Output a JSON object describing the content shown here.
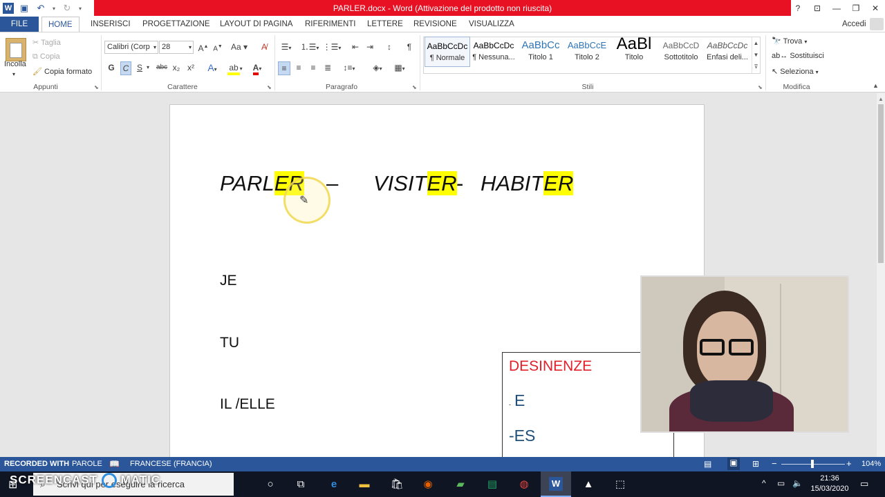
{
  "titlebar": {
    "title": "PARLER.docx  -  Word (Attivazione del prodotto non riuscita)",
    "help": "?",
    "ribbon_display": "⊡",
    "minimize": "—",
    "restore": "❐",
    "close": "✕"
  },
  "tabs": {
    "file": "FILE",
    "home": "HOME",
    "insert": "INSERISCI",
    "design": "PROGETTAZIONE",
    "layout": "LAYOUT DI PAGINA",
    "references": "RIFERIMENTI",
    "mailings": "LETTERE",
    "review": "REVISIONE",
    "view": "VISUALIZZA",
    "signin": "Accedi"
  },
  "clipboard": {
    "paste": "Incolla",
    "cut": "Taglia",
    "copy": "Copia",
    "format_painter": "Copia formato",
    "group": "Appunti"
  },
  "font": {
    "name": "Calibri (Corp",
    "size": "28",
    "bold": "G",
    "italic": "C",
    "underline": "S",
    "strike": "abc",
    "subscript": "x₂",
    "superscript": "x²",
    "group": "Carattere"
  },
  "paragraph": {
    "group": "Paragrafo"
  },
  "styles": {
    "group": "Stili",
    "items": [
      {
        "preview": "AaBbCcDc",
        "name": "¶ Normale"
      },
      {
        "preview": "AaBbCcDc",
        "name": "¶ Nessuna..."
      },
      {
        "preview": "AaBbCc",
        "name": "Titolo 1"
      },
      {
        "preview": "AaBbCcE",
        "name": "Titolo 2"
      },
      {
        "preview": "AaBl",
        "name": "Titolo"
      },
      {
        "preview": "AaBbCcD",
        "name": "Sottotitolo"
      },
      {
        "preview": "AaBbCcDc",
        "name": "Enfasi deli..."
      }
    ]
  },
  "editing": {
    "find": "Trova",
    "replace": "Sostituisci",
    "select": "Seleziona",
    "group": "Modifica"
  },
  "document": {
    "w1a": "PARL",
    "w1b": "ER",
    "dash1": "–",
    "w2a": "VISIT",
    "w2b": "ER",
    "dash2": "-",
    "w3a": "HABIT",
    "w3b": "ER",
    "p1": "JE",
    "p2": "TU",
    "p3": "IL /ELLE",
    "desinenze_title": "DESINENZE",
    "d1_dash": "-",
    "d1": "E",
    "d2": "-ES"
  },
  "colors": {
    "word_blue": "#2b579a",
    "title_red": "#e81123",
    "highlight": "#ffff00",
    "desinenze_red": "#e0202a",
    "desinenze_blue": "#1f4e79"
  },
  "statusbar": {
    "words": "PAROLE",
    "recorded": "RECORDED WITH",
    "language": "FRANCESE (FRANCIA)",
    "zoom": "104%"
  },
  "taskbar": {
    "screencast": "SCREENCAST",
    "matic": "MATIC",
    "search": "Scrivi qui per eseguire la ricerca",
    "time": "21:36",
    "date": "15/03/2020"
  }
}
